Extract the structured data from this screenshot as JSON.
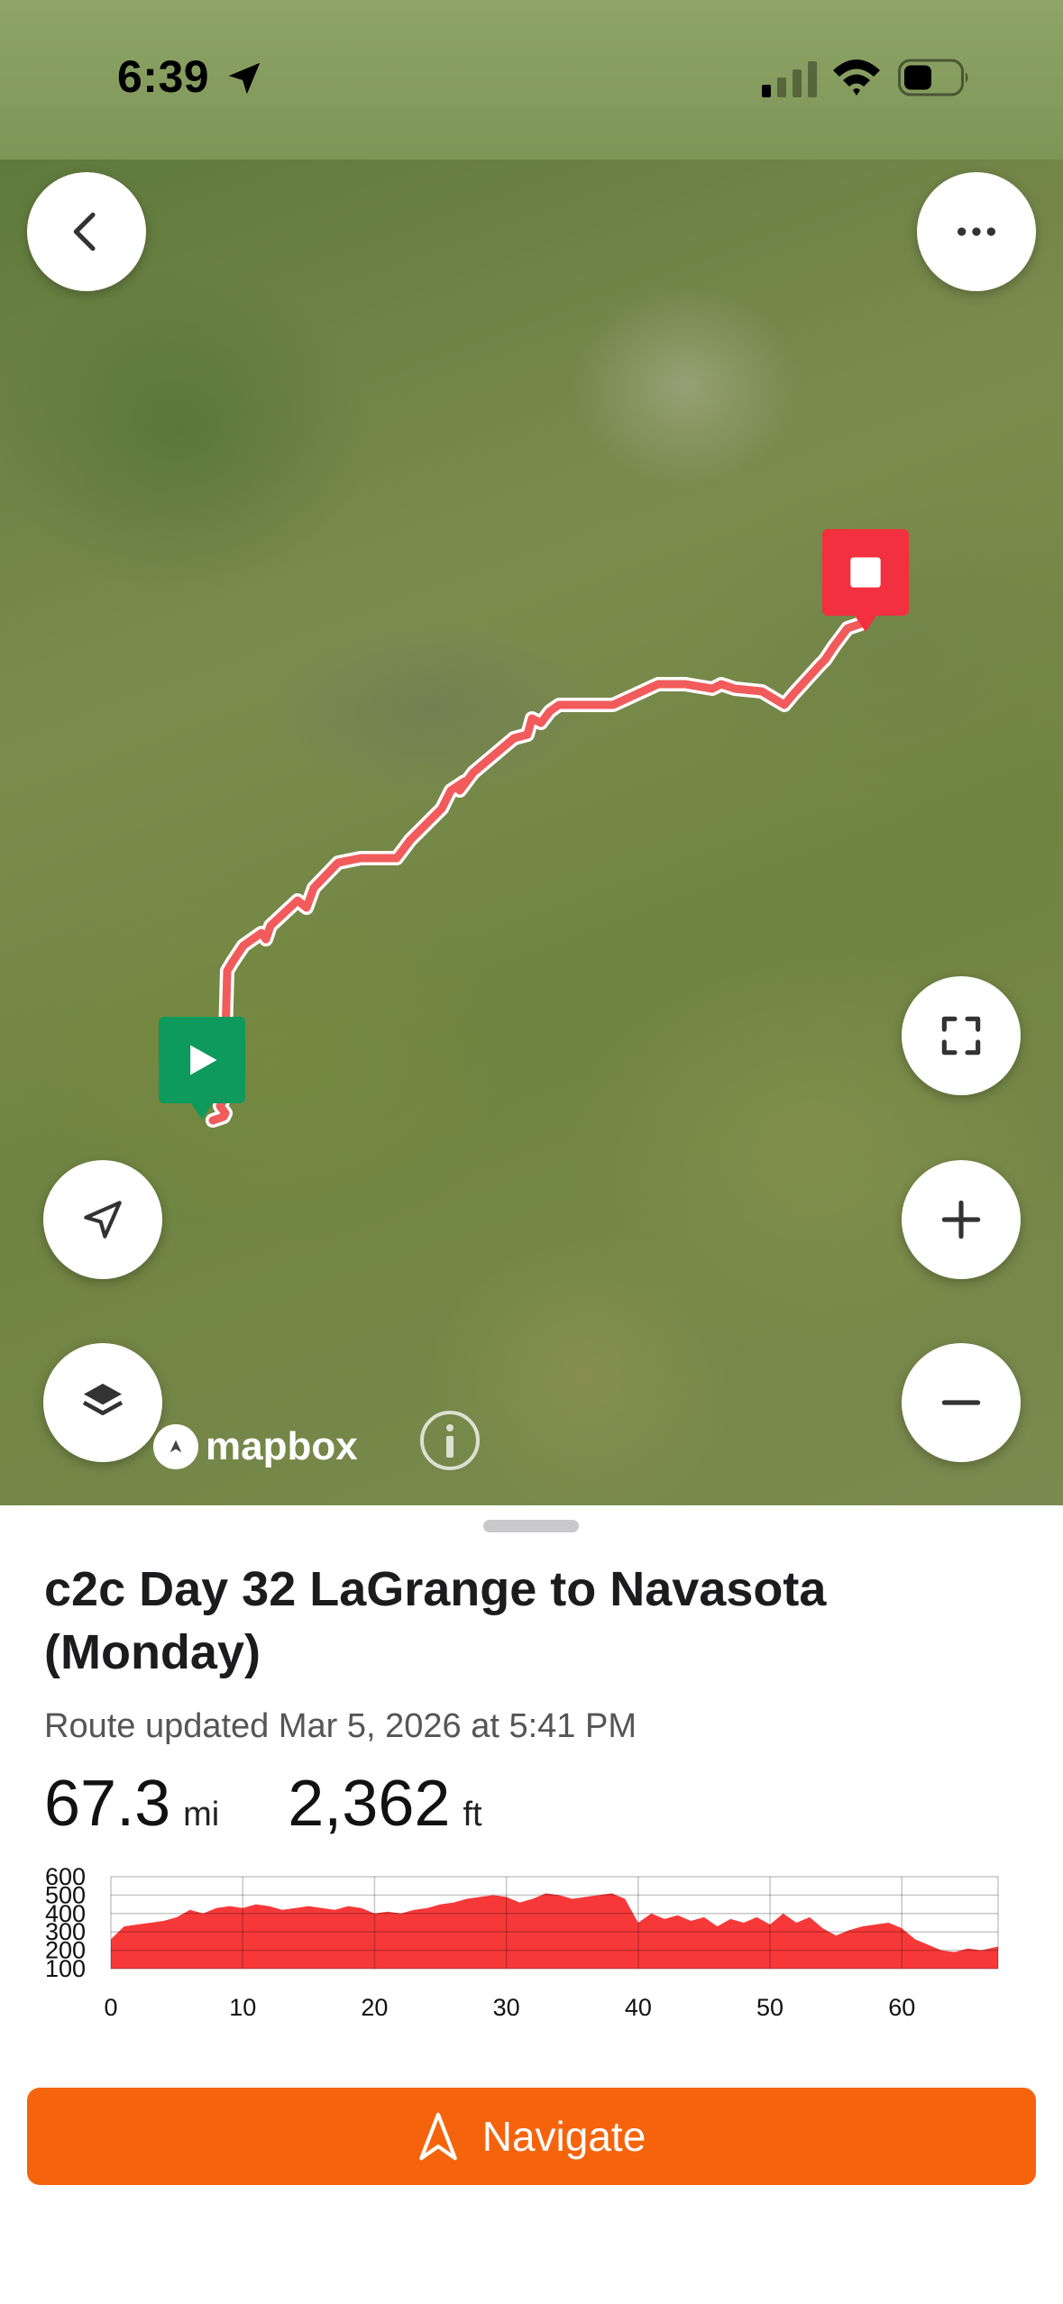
{
  "status_bar": {
    "time": "6:39"
  },
  "map": {
    "attribution": "mapbox",
    "icons": {
      "back": "chevron-left-icon",
      "more": "ellipsis-icon",
      "fullscreen": "fullscreen-icon",
      "locate": "location-arrow-icon",
      "zoom_in": "plus-icon",
      "zoom_out": "minus-icon",
      "layers": "layers-icon",
      "info": "info-icon"
    },
    "route_color": "#f25b5b",
    "start_color": "#0e9a5c",
    "end_color": "#f2303f"
  },
  "route": {
    "title": "c2c Day 32 LaGrange to Navasota (Monday)",
    "updated": "Route updated Mar 5, 2026 at 5:41 PM",
    "distance": "67.3",
    "distance_unit": "mi",
    "elevation_gain": "2,362",
    "elevation_unit": "ft"
  },
  "chart_data": {
    "type": "area",
    "title": "",
    "xlabel": "",
    "ylabel": "",
    "xlim": [
      0,
      67.3
    ],
    "ylim": [
      100,
      600
    ],
    "x_ticks": [
      0,
      10,
      20,
      30,
      40,
      50,
      60
    ],
    "y_ticks": [
      100,
      200,
      300,
      400,
      500,
      600
    ],
    "grid": true,
    "color": "#f73838",
    "x": [
      0,
      1,
      2,
      3,
      4,
      5,
      6,
      7,
      8,
      9,
      10,
      11,
      12,
      13,
      14,
      15,
      16,
      17,
      18,
      19,
      20,
      21,
      22,
      23,
      24,
      25,
      26,
      27,
      28,
      29,
      30,
      31,
      32,
      33,
      34,
      35,
      36,
      37,
      38,
      39,
      40,
      41,
      42,
      43,
      44,
      45,
      46,
      47,
      48,
      49,
      50,
      51,
      52,
      53,
      54,
      55,
      56,
      57,
      58,
      59,
      60,
      61,
      62,
      63,
      64,
      65,
      66,
      67.3
    ],
    "y": [
      260,
      330,
      340,
      350,
      360,
      380,
      420,
      400,
      430,
      440,
      430,
      450,
      440,
      420,
      430,
      440,
      430,
      420,
      440,
      430,
      400,
      410,
      400,
      420,
      430,
      450,
      460,
      480,
      490,
      500,
      490,
      460,
      480,
      510,
      500,
      480,
      490,
      500,
      510,
      480,
      350,
      400,
      370,
      390,
      360,
      380,
      330,
      370,
      350,
      380,
      340,
      400,
      350,
      380,
      320,
      280,
      310,
      330,
      340,
      350,
      320,
      260,
      230,
      200,
      190,
      210,
      200,
      220
    ]
  },
  "actions": {
    "navigate_label": "Navigate"
  }
}
